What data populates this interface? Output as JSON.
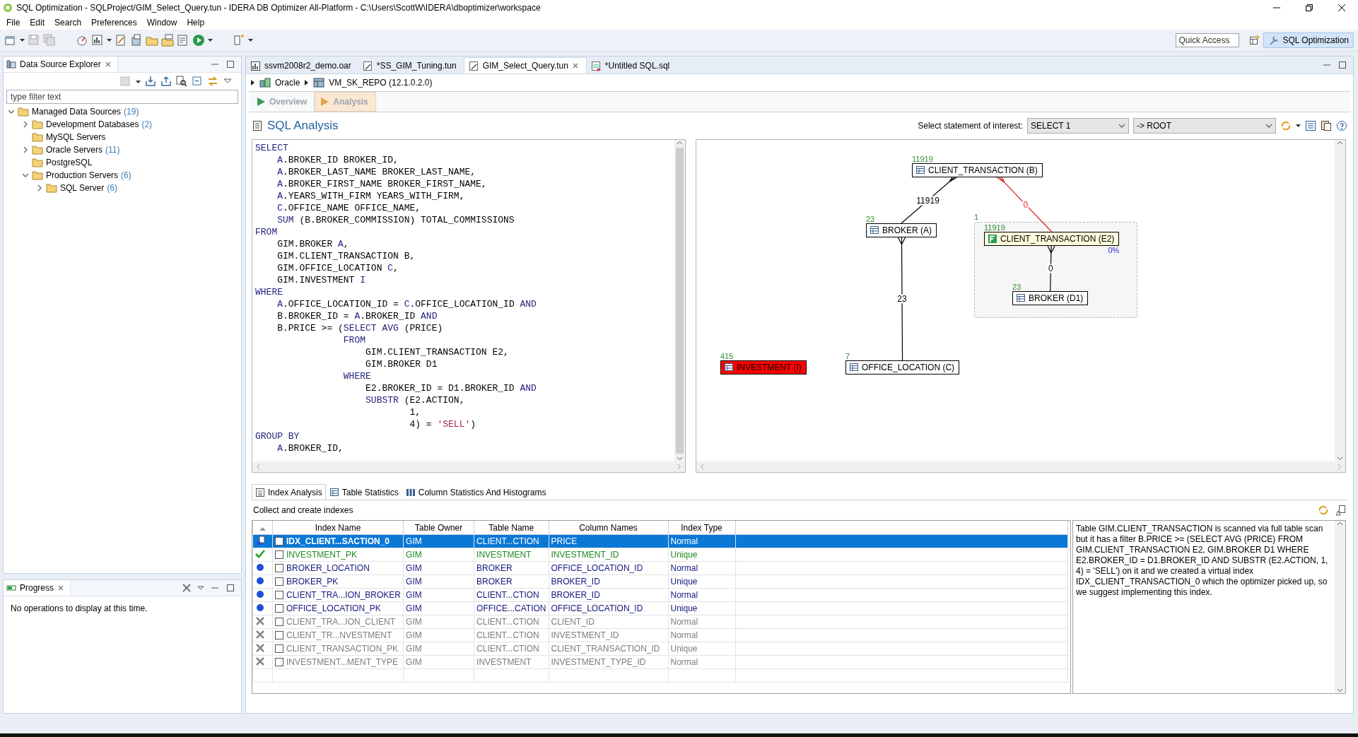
{
  "window": {
    "title": "SQL Optimization - SQLProject/GIM_Select_Query.tun - IDERA DB Optimizer All-Platform - C:\\Users\\ScottW\\IDERA\\dboptimizer\\workspace"
  },
  "menu": [
    "File",
    "Edit",
    "Search",
    "Preferences",
    "Window",
    "Help"
  ],
  "quick_access": {
    "placeholder": "Quick Access"
  },
  "perspective": {
    "label": "SQL Optimization",
    "selected": true
  },
  "explorer": {
    "title": "Data Source Explorer",
    "filter": {
      "placeholder": "type filter text"
    },
    "tree": [
      {
        "label": "Managed Data Sources",
        "count": "(19)",
        "expanded": true,
        "children": [
          {
            "label": "Development Databases",
            "count": "(2)",
            "expanded": false
          },
          {
            "label": "MySQL Servers"
          },
          {
            "label": "Oracle Servers",
            "count": "(11)",
            "expanded": false
          },
          {
            "label": "PostgreSQL"
          },
          {
            "label": "Production Servers",
            "count": "(6)",
            "expanded": true,
            "children": [
              {
                "label": "SQL Server",
                "count": "(6)",
                "expanded": false
              }
            ]
          }
        ]
      }
    ]
  },
  "progress": {
    "title": "Progress",
    "message": "No operations to display at this time."
  },
  "editor_tabs": [
    {
      "label": "ssvm2008r2_demo.oar",
      "kind": "chart",
      "selected": false
    },
    {
      "label": "*SS_GIM_Tuning.tun",
      "kind": "tuning",
      "selected": false
    },
    {
      "label": "GIM_Select_Query.tun",
      "kind": "tuning",
      "selected": true
    },
    {
      "label": "*Untitled SQL.sql",
      "kind": "sql",
      "selected": false
    }
  ],
  "breadcrumb": [
    "Oracle",
    "VM_SK_REPO (12.1.0.2.0)"
  ],
  "pages": [
    {
      "label": "Overview",
      "selected": false
    },
    {
      "label": "Analysis",
      "selected": true
    }
  ],
  "analysis": {
    "title": "SQL Analysis",
    "statement_label": "Select statement of interest:",
    "statement": "SELECT 1",
    "scope": "-> ROOT"
  },
  "sql": [
    [
      {
        "text": "SELECT",
        "kind": "keyword"
      }
    ],
    [
      {
        "text": "    A",
        "kind": "keyword"
      },
      {
        "text": ".BROKER_ID BROKER_ID,",
        "kind": "plain"
      }
    ],
    [
      {
        "text": "    A",
        "kind": "keyword"
      },
      {
        "text": ".BROKER_LAST_NAME BROKER_LAST_NAME,",
        "kind": "plain"
      }
    ],
    [
      {
        "text": "    A",
        "kind": "keyword"
      },
      {
        "text": ".BROKER_FIRST_NAME BROKER_FIRST_NAME,",
        "kind": "plain"
      }
    ],
    [
      {
        "text": "    A",
        "kind": "keyword"
      },
      {
        "text": ".YEARS_WITH_FIRM YEARS_WITH_FIRM,",
        "kind": "plain"
      }
    ],
    [
      {
        "text": "    C",
        "kind": "keyword"
      },
      {
        "text": ".OFFICE_NAME OFFICE_NAME,",
        "kind": "plain"
      }
    ],
    [
      {
        "text": "    SUM",
        "kind": "keyword"
      },
      {
        "text": " (B.BROKER_COMMISSION) TOTAL_COMMISSIONS",
        "kind": "plain"
      }
    ],
    [
      {
        "text": "FROM",
        "kind": "keyword"
      }
    ],
    [
      {
        "text": "    GIM.BROKER",
        "kind": "plain"
      },
      {
        "text": " A",
        "kind": "keyword"
      },
      {
        "text": ",",
        "kind": "plain"
      }
    ],
    [
      {
        "text": "    GIM.CLIENT_TRANSACTION B,",
        "kind": "plain"
      }
    ],
    [
      {
        "text": "    GIM.OFFICE_LOCATION",
        "kind": "plain"
      },
      {
        "text": " C",
        "kind": "keyword"
      },
      {
        "text": ",",
        "kind": "plain"
      }
    ],
    [
      {
        "text": "    GIM.INVESTMENT",
        "kind": "plain"
      },
      {
        "text": " I",
        "kind": "keyword"
      }
    ],
    [
      {
        "text": "WHERE",
        "kind": "keyword"
      }
    ],
    [
      {
        "text": "    A",
        "kind": "keyword"
      },
      {
        "text": ".OFFICE_LOCATION_ID = ",
        "kind": "plain"
      },
      {
        "text": "C",
        "kind": "keyword"
      },
      {
        "text": ".OFFICE_LOCATION_ID",
        "kind": "plain"
      },
      {
        "text": " AND",
        "kind": "keyword"
      }
    ],
    [
      {
        "text": "    B.BROKER_ID = ",
        "kind": "plain"
      },
      {
        "text": "A",
        "kind": "keyword"
      },
      {
        "text": ".BROKER_ID",
        "kind": "plain"
      },
      {
        "text": " AND",
        "kind": "keyword"
      }
    ],
    [
      {
        "text": "    B.PRICE >= (",
        "kind": "plain"
      },
      {
        "text": "SELECT AVG",
        "kind": "keyword"
      },
      {
        "text": " (PRICE)",
        "kind": "plain"
      }
    ],
    [
      {
        "text": "                FROM",
        "kind": "keyword"
      }
    ],
    [
      {
        "text": "                    GIM.CLIENT_TRANSACTION E2,",
        "kind": "plain"
      }
    ],
    [
      {
        "text": "                    GIM.BROKER D1",
        "kind": "plain"
      }
    ],
    [
      {
        "text": "                WHERE",
        "kind": "keyword"
      }
    ],
    [
      {
        "text": "                    E2.BROKER_ID = D1.BROKER_ID",
        "kind": "plain"
      },
      {
        "text": " AND",
        "kind": "keyword"
      }
    ],
    [
      {
        "text": "                    SUBSTR",
        "kind": "keyword"
      },
      {
        "text": " (E2.ACTION,",
        "kind": "plain"
      }
    ],
    [
      {
        "text": "                            1,",
        "kind": "plain"
      }
    ],
    [
      {
        "text": "                            4) = ",
        "kind": "plain"
      },
      {
        "text": "'SELL'",
        "kind": "string"
      },
      {
        "text": ")",
        "kind": "plain"
      }
    ],
    [
      {
        "text": "GROUP BY",
        "kind": "keyword"
      }
    ],
    [
      {
        "text": "    A",
        "kind": "keyword"
      },
      {
        "text": ".BROKER_ID,",
        "kind": "plain"
      }
    ]
  ],
  "diagram": {
    "nodes": [
      {
        "label": "CLIENT_TRANSACTION (B)",
        "count": "11919",
        "kind": "table"
      },
      {
        "label": "BROKER (A)",
        "count": "23",
        "kind": "table"
      },
      {
        "label": "CLIENT_TRANSACTION (E2)",
        "count": "11919",
        "kind": "filtered",
        "filter_pct": "0%"
      },
      {
        "label": "BROKER (D1)",
        "count": "23",
        "kind": "table"
      },
      {
        "label": "INVESTMENT (I)",
        "count": "415",
        "kind": "unjoined"
      },
      {
        "label": "OFFICE_LOCATION (C)",
        "count": "7",
        "kind": "table"
      }
    ],
    "edges": [
      {
        "label": "11919",
        "color": "#000000"
      },
      {
        "label": "0",
        "color": "#e02020"
      },
      {
        "label": "23",
        "color": "#000000"
      },
      {
        "label": "0",
        "color": "#000000"
      }
    ],
    "subquery": {
      "count": "1"
    }
  },
  "bottom_tabs": [
    {
      "label": "Index Analysis",
      "selected": true
    },
    {
      "label": "Table Statistics",
      "selected": false
    },
    {
      "label": "Column Statistics And Histograms",
      "selected": false
    }
  ],
  "indexes": {
    "caption": "Collect and create indexes",
    "columns": [
      "Index Name",
      "Table Owner",
      "Table Name",
      "Column Names",
      "Index Type"
    ],
    "rows": [
      {
        "kind": "virtual",
        "selected": true,
        "checked": false,
        "cells": [
          "IDX_CLIENT...SACTION_0",
          "GIM",
          "CLIENT...CTION",
          "PRICE",
          "Normal"
        ]
      },
      {
        "kind": "used",
        "selected": false,
        "checked": false,
        "cells": [
          "INVESTMENT_PK",
          "GIM",
          "INVESTMENT",
          "INVESTMENT_ID",
          "Unique"
        ]
      },
      {
        "kind": "candidate",
        "selected": false,
        "checked": false,
        "cells": [
          "BROKER_LOCATION",
          "GIM",
          "BROKER",
          "OFFICE_LOCATION_ID",
          "Normal"
        ]
      },
      {
        "kind": "candidate",
        "selected": false,
        "checked": false,
        "cells": [
          "BROKER_PK",
          "GIM",
          "BROKER",
          "BROKER_ID",
          "Unique"
        ]
      },
      {
        "kind": "candidate",
        "selected": false,
        "checked": false,
        "cells": [
          "CLIENT_TRA...ION_BROKER",
          "GIM",
          "CLIENT...CTION",
          "BROKER_ID",
          "Normal"
        ]
      },
      {
        "kind": "candidate",
        "selected": false,
        "checked": false,
        "cells": [
          "OFFICE_LOCATION_PK",
          "GIM",
          "OFFICE...CATION",
          "OFFICE_LOCATION_ID",
          "Unique"
        ]
      },
      {
        "kind": "rejected",
        "selected": false,
        "checked": false,
        "cells": [
          "CLIENT_TRA...ION_CLIENT",
          "GIM",
          "CLIENT...CTION",
          "CLIENT_ID",
          "Normal"
        ]
      },
      {
        "kind": "rejected",
        "selected": false,
        "checked": false,
        "cells": [
          "CLIENT_TR...NVESTMENT",
          "GIM",
          "CLIENT...CTION",
          "INVESTMENT_ID",
          "Normal"
        ]
      },
      {
        "kind": "rejected",
        "selected": false,
        "checked": false,
        "cells": [
          "CLIENT_TRANSACTION_PK",
          "GIM",
          "CLIENT...CTION",
          "CLIENT_TRANSACTION_ID",
          "Unique"
        ]
      },
      {
        "kind": "rejected",
        "selected": false,
        "checked": false,
        "cells": [
          "INVESTMENT...MENT_TYPE",
          "GIM",
          "INVESTMENT",
          "INVESTMENT_TYPE_ID",
          "Normal"
        ]
      }
    ]
  },
  "description": "Table GIM.CLIENT_TRANSACTION is scanned via full table scan but it has a filter  B.PRICE >= (SELECT AVG (PRICE) FROM GIM.CLIENT_TRANSACTION E2, GIM.BROKER D1 WHERE E2.BROKER_ID = D1.BROKER_ID AND SUBSTR (E2.ACTION, 1, 4) = 'SELL') on it and we created a virtual index IDX_CLIENT_TRANSACTION_0 which the optimizer picked up, so we suggest implementing this index."
}
